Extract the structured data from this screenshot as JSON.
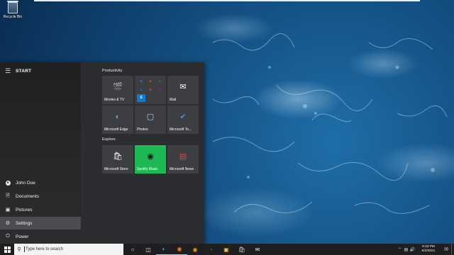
{
  "desktop": {
    "icons": [
      {
        "label": "Recycle Bin",
        "icon": "recycle-bin-icon"
      }
    ]
  },
  "start_menu": {
    "title": "START",
    "rail_items": [
      {
        "label": "John Doe",
        "icon": "user-icon"
      },
      {
        "label": "Documents",
        "icon": "document-icon"
      },
      {
        "label": "Pictures",
        "icon": "picture-icon"
      },
      {
        "label": "Settings",
        "icon": "gear-icon",
        "active": true
      },
      {
        "label": "Power",
        "icon": "power-icon"
      }
    ],
    "groups": [
      {
        "title": "Productivity",
        "tiles": [
          {
            "label": "Movies & TV",
            "icon": "movies-icon"
          },
          {
            "label": "",
            "icon": "office-apps-folder-icon"
          },
          {
            "label": "Mail",
            "icon": "mail-icon"
          },
          {
            "label": "Microsoft Edge",
            "icon": "edge-icon"
          },
          {
            "label": "Photos",
            "icon": "photos-icon"
          },
          {
            "label": "Microsoft To...",
            "icon": "todo-icon"
          }
        ]
      },
      {
        "title": "Explore",
        "tiles": [
          {
            "label": "Microsoft Store",
            "icon": "store-icon"
          },
          {
            "label": "Spotify Music",
            "icon": "spotify-icon"
          },
          {
            "label": "Microsoft News",
            "icon": "news-icon"
          }
        ]
      }
    ]
  },
  "taskbar": {
    "search_placeholder": "Type here to search",
    "apps": [
      {
        "icon": "task-view-circle-icon"
      },
      {
        "icon": "timeline-icon"
      },
      {
        "icon": "edge-icon"
      },
      {
        "icon": "firefox-icon"
      },
      {
        "icon": "firefox-alt-icon"
      },
      {
        "icon": "chrome-icon"
      },
      {
        "icon": "file-explorer-icon"
      },
      {
        "icon": "store-icon"
      },
      {
        "icon": "mail-icon"
      }
    ],
    "clock": {
      "time": "8:33 PM",
      "date": "6/2/2021"
    }
  },
  "colors": {
    "start_bg": "#2b2d30",
    "tile_bg": "#3c3e41",
    "spotify_green": "#1db954",
    "taskbar_bg": "#1f1f22",
    "accent_blue": "#0a7bd6"
  }
}
